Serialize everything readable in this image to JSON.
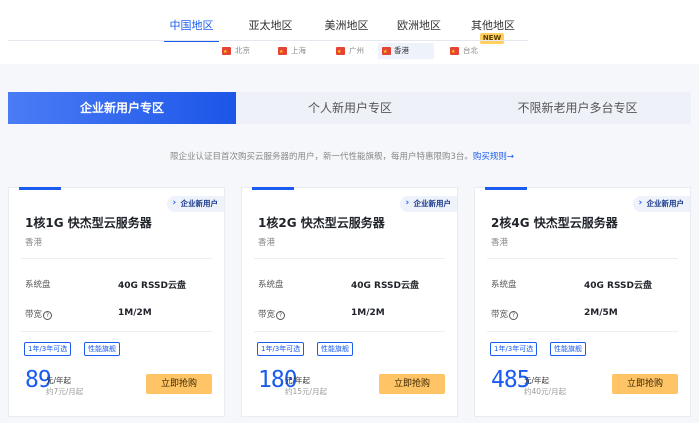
{
  "regions": [
    {
      "label": "中国地区",
      "active": true
    },
    {
      "label": "亚太地区",
      "active": false
    },
    {
      "label": "美洲地区",
      "active": false
    },
    {
      "label": "欧洲地区",
      "active": false
    },
    {
      "label": "其他地区",
      "active": false
    }
  ],
  "new_badge": "NEW",
  "cities": [
    {
      "label": "北京",
      "active": false
    },
    {
      "label": "上海",
      "active": false
    },
    {
      "label": "广州",
      "active": false
    },
    {
      "label": "香港",
      "active": true
    },
    {
      "label": "台北",
      "active": false
    }
  ],
  "tabs": [
    {
      "label": "企业新用户专区",
      "active": true
    },
    {
      "label": "个人新用户专区",
      "active": false
    },
    {
      "label": "不限新老用户多台专区",
      "active": false
    }
  ],
  "notice": {
    "text": "限企业认证目首次购买云服务器的用户，新一代性能旗舰，每用户特惠限购3台。",
    "link": "购买规则→"
  },
  "cards": [
    {
      "badge": "企业新用户",
      "title": "1核1G 快杰型云服务器",
      "location": "香港",
      "disk_label": "系统盘",
      "disk_value": "40G RSSD云盘",
      "bandwidth_label": "带宽",
      "bandwidth_value": "1M/2M",
      "tags": [
        "1年/3年可选",
        "性能旗舰"
      ],
      "price": "89",
      "price_unit": "元/年起",
      "price_sub": "约7元/月起",
      "buy_label": "立即抢购"
    },
    {
      "badge": "企业新用户",
      "title": "1核2G 快杰型云服务器",
      "location": "香港",
      "disk_label": "系统盘",
      "disk_value": "40G RSSD云盘",
      "bandwidth_label": "带宽",
      "bandwidth_value": "1M/2M",
      "tags": [
        "1年/3年可选",
        "性能旗舰"
      ],
      "price": "180",
      "price_unit": "元/年起",
      "price_sub": "约15元/月起",
      "buy_label": "立即抢购"
    },
    {
      "badge": "企业新用户",
      "title": "2核4G 快杰型云服务器",
      "location": "香港",
      "disk_label": "系统盘",
      "disk_value": "40G RSSD云盘",
      "bandwidth_label": "带宽",
      "bandwidth_value": "2M/5M",
      "tags": [
        "1年/3年可选",
        "性能旗舰"
      ],
      "price": "485",
      "price_unit": "元/年起",
      "price_sub": "约40元/月起",
      "buy_label": "立即抢购"
    }
  ],
  "colors": {
    "accent": "#1a5cf0",
    "buy": "#ffc466",
    "new_badge": "#ffd060",
    "flag": "#e54335"
  },
  "icons": {
    "city_flag": "china-flag-icon",
    "help": "question-circle-icon"
  }
}
